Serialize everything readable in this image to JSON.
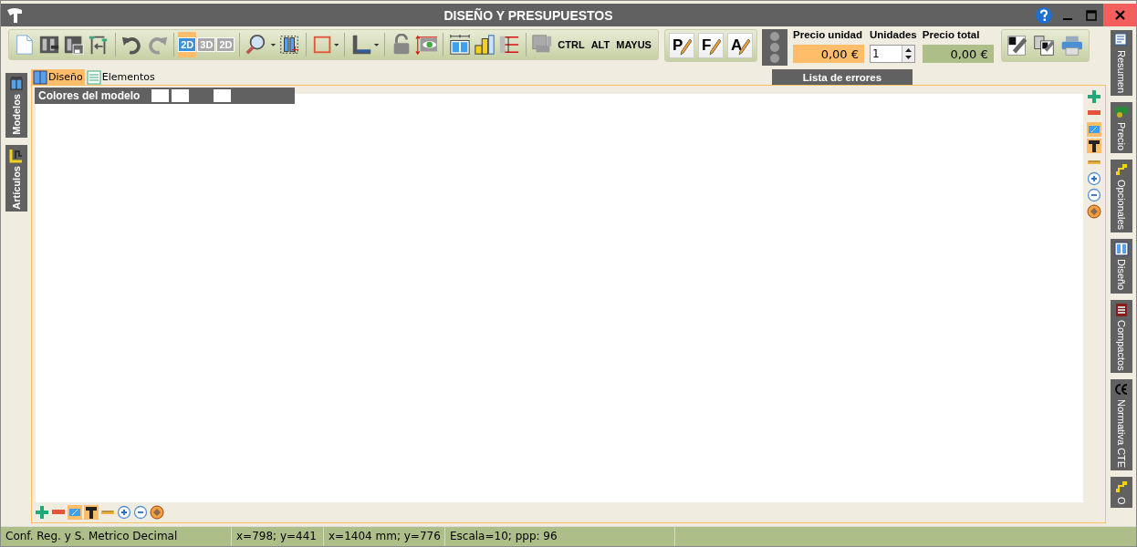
{
  "window": {
    "title": "DISEÑO Y PRESUPUESTOS"
  },
  "view_modes": [
    {
      "label": "2D",
      "selected": true,
      "disabled": false
    },
    {
      "label": "3D",
      "selected": false,
      "disabled": true
    },
    {
      "label": "2D",
      "selected": false,
      "disabled": true
    }
  ],
  "key_labels": [
    "CTRL",
    "ALT",
    "MAYUS"
  ],
  "doc_buttons": [
    "P",
    "F",
    "A"
  ],
  "price": {
    "unit_label": "Precio unidad",
    "unit_value": "0,00 €",
    "units_label": "Unidades",
    "units_value": "1",
    "total_label": "Precio total",
    "total_value": "0,00 €"
  },
  "errors_button": "Lista de errores",
  "content_tabs": [
    {
      "label": "Diseño",
      "selected": true
    },
    {
      "label": "Elementos",
      "selected": false
    }
  ],
  "model_colors": {
    "label": "Colores del modelo",
    "swatches": [
      {
        "color": "#ffffff"
      },
      {
        "color": "#ffffff"
      },
      {
        "color": "#ffffff"
      }
    ]
  },
  "left_tabs": [
    {
      "label": "Modelos"
    },
    {
      "label": "Artículos"
    }
  ],
  "right_tabs": [
    {
      "label": "Resumen"
    },
    {
      "label": "Precio"
    },
    {
      "label": "Opcionales"
    },
    {
      "label": "Diseño"
    },
    {
      "label": "Compactos"
    },
    {
      "label": "Normativa CTE"
    },
    {
      "label": "O"
    }
  ],
  "canvas_tools": [
    {
      "selected": false
    },
    {
      "selected": false
    },
    {
      "selected": true
    },
    {
      "selected": true
    },
    {
      "selected": false
    },
    {
      "selected": false
    },
    {
      "selected": false
    },
    {
      "selected": false
    }
  ],
  "bottom_tools": [
    {
      "selected": false
    },
    {
      "selected": false
    },
    {
      "selected": true
    },
    {
      "selected": true
    },
    {
      "selected": false
    },
    {
      "selected": false
    },
    {
      "selected": false
    },
    {
      "selected": false
    }
  ],
  "status_bar": [
    "Conf. Reg. y S. Metrico Decimal",
    "x=798; y=441",
    "x=1404 mm; y=776",
    "Escala=10; ppp: 96"
  ]
}
